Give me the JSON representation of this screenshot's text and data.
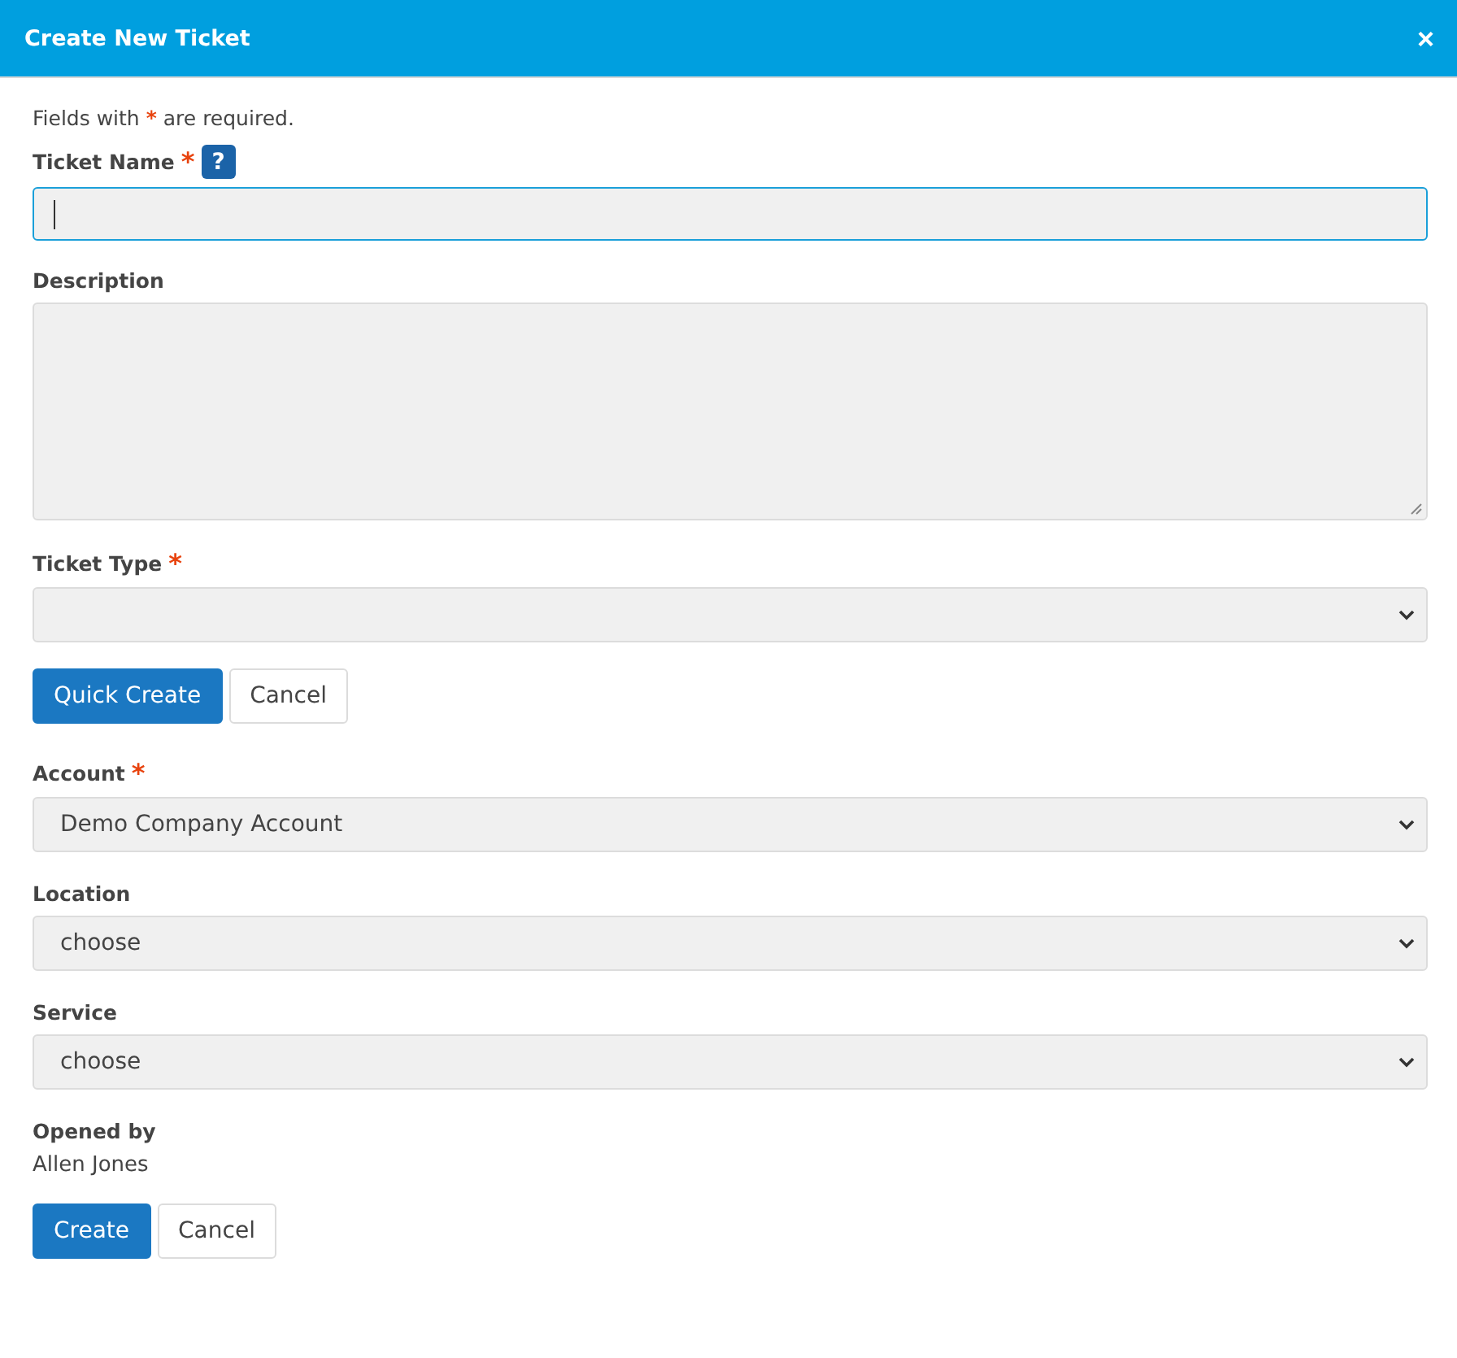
{
  "dialog": {
    "title": "Create New Ticket",
    "close": "×"
  },
  "notice": {
    "before": "Fields with",
    "mark": "*",
    "after": "are required."
  },
  "items": [
    {
      "kind": "text",
      "label": "Ticket Name",
      "required_mark": "*",
      "help": "?",
      "focused": true
    },
    {
      "kind": "textarea",
      "label": "Description"
    },
    {
      "kind": "select",
      "label": "Ticket Type",
      "required_mark": "*"
    },
    {
      "kind": "buttons",
      "buttons": [
        {
          "label": "Quick Create",
          "primary": true
        },
        {
          "label": "Cancel",
          "primary": false
        }
      ]
    },
    {
      "kind": "select",
      "label": "Account",
      "required_mark": "*",
      "value": "Demo Company Account"
    },
    {
      "kind": "select",
      "label": "Location",
      "value": "choose"
    },
    {
      "kind": "select",
      "label": "Service",
      "value": "choose"
    },
    {
      "kind": "static",
      "label": "Opened by",
      "value": "Allen Jones"
    },
    {
      "kind": "buttons",
      "buttons": [
        {
          "label": "Create",
          "primary": true
        },
        {
          "label": "Cancel",
          "primary": false
        }
      ]
    }
  ]
}
